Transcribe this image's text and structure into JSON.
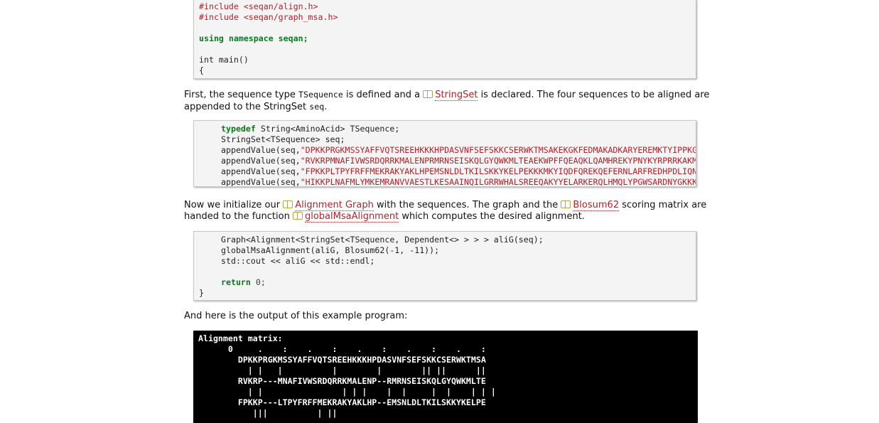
{
  "code_top": {
    "lines": [
      "#include <seqan/align.h>",
      "#include <seqan/graph_msa.h>",
      "",
      "using namespace seqan;",
      "",
      "int main()",
      "{"
    ]
  },
  "para1": {
    "t1": "First, the sequence type ",
    "c1": "TSequence",
    "t2": " is defined and a ",
    "link": "StringSet",
    "t3": " is declared. The four sequences to be aligned are appended to the StringSet ",
    "c2": "seq",
    "t4": "."
  },
  "code_seq": {
    "typedef_kw": "typedef",
    "typedef_rest": " String<AminoAcid> TSequence;",
    "stringset_line": "StringSet<TSequence> seq;",
    "append_prefix": "appendValue(seq,",
    "sequences": [
      "\"DPKKPRGKMSSYAFFVQTSREEHKKKHPDASVNFSEFSKKCSERWKTMSAKEKGKFEDMAKADKARYEREMKTYIPPKGE\");",
      "\"RVKRPMNAFIVWSRDQRRKMALENPRMRNSEISKQLGYQWKMLTEAEKWPFFQEAQKLQAMHREKYPNYKYRPRRKAKMLPK\");",
      "\"FPKKPLTPYFRFFMEKRAKYAKLHPEMSNLDLTKILSKKYKELPEKKKMKYIQDFQREKQEFERNLARFREDHPDLIQNAKK\");",
      "\"HIKKPLNAFMLYMKEMRANVVAESTLKESAAINQILGRRWHALSREEQAKYYELARKERQLHMQLYPGWSARDNYGKKKKRKREK\");"
    ]
  },
  "para2": {
    "t1": "Now we initialize our ",
    "link1": "Alignment Graph",
    "t2": " with the sequences. The graph and the ",
    "link2": "Blosum62",
    "t3": " scoring matrix are handed to the function ",
    "link3": "globalMsaAlignment",
    "t4": " which computes the desired alignment."
  },
  "code_graph": {
    "line1": "Graph<Alignment<StringSet<TSequence, Dependent<> > > > aliG(seq);",
    "line2": "globalMsaAlignment(aliG, Blosum62(-1, -11));",
    "line3": "std::cout << aliG << std::endl;",
    "return_kw": "return",
    "return_rest": " 0;",
    "closing": "}"
  },
  "para3": "And here is the output of this example program:",
  "output": {
    "lines": [
      "Alignment matrix:",
      "      0     .    :    .    :    .    :    .    :    .    :",
      "        DPKKPRGKMSSYAFFVQTSREEHKKKHPDASVNFSEFSKKCSERWKTMSA",
      "          | |   |          |        |        || ||      ||",
      "        RVKRP---MNAFIVWSRDQRRKMALENP--RMRNSEISKQLGYQWKMLTE",
      "          | |                | | |    |  |     |  |    | | |",
      "        FPKKP---LTPYFRFFMEKRAKYAKLHP--EMSNLDLTKILSKKYKELPE",
      "           |||          | ||"
    ]
  }
}
